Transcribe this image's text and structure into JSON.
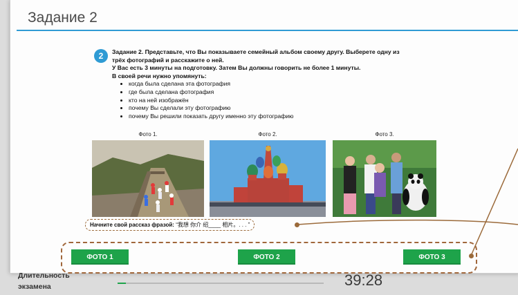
{
  "title": "Задание 2",
  "task": {
    "number": "2",
    "lines": [
      "Задание 2. Представьте, что Вы показываете семейный альбом своему другу. Выберете одну из",
      "трёх фотографий и расскажите о ней.",
      "У Вас есть 3 минуты на подготовку. Затем Вы должны говорить не более 1 минуты.",
      "В своей речи нужно упомянуть:"
    ],
    "bullets": [
      "когда была сделана эта фотография",
      "где была сделана фотография",
      "кто на ней изображён",
      "почему Вы сделали эту фотографию",
      "почему Вы решили показать другу именно эту фотографию"
    ]
  },
  "photos": [
    {
      "caption": "Фото 1.",
      "icon": "great-wall-photo"
    },
    {
      "caption": "Фото 2.",
      "icon": "moscow-cathedral-photo"
    },
    {
      "caption": "Фото 3.",
      "icon": "group-with-panda-photo"
    }
  ],
  "phrase": {
    "label": "Начните свой рассказ фразой:",
    "value": "“我想 你介 绍____ 相片。. . . ”"
  },
  "buttons": [
    "ФОТО 1",
    "ФОТО 2",
    "ФОТО 3"
  ],
  "footer": {
    "label_line1": "Длительность",
    "label_line2": "экзамена",
    "progress": 0.04,
    "timer": "39:28"
  },
  "colors": {
    "accent": "#2f9bd4",
    "button": "#1ea34a",
    "annotation": "#9b6a3a"
  }
}
